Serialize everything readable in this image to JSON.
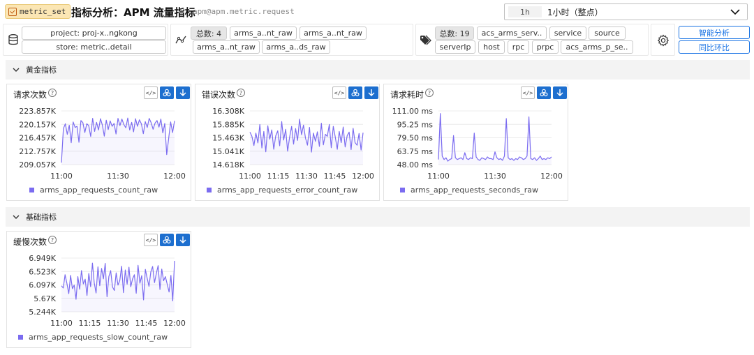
{
  "header": {
    "tag": "metric_set",
    "title": "指标分析：APM 流量指标",
    "subtitle": "apm@apm.metric.request",
    "time_unit": "1h",
    "time_label": "1小时（整点）"
  },
  "filters": {
    "source_group": {
      "project": "project: proj-x..ngkong",
      "store": "store: metric..detail"
    },
    "metric_group": {
      "count": "总数: 4",
      "items": [
        "arms_a..nt_raw",
        "arms_a..nt_raw",
        "arms_a..nt_raw",
        "arms_a..ds_raw"
      ]
    },
    "tag_group": {
      "count": "总数: 19",
      "items": [
        "acs_arms_serv..",
        "service",
        "source",
        "serverIp",
        "host",
        "rpc",
        "prpc",
        "acs_arms_p_se.."
      ]
    },
    "actions": {
      "smart_analysis": "智能分析",
      "compare": "同比环比"
    }
  },
  "sections": {
    "golden": "黄金指标",
    "basic": "基础指标"
  },
  "panels": [
    {
      "title": "请求次数",
      "legend": "arms_app_requests_count_raw",
      "y_ticks": [
        "223.857K",
        "220.157K",
        "216.457K",
        "212.757K",
        "209.057K"
      ],
      "x_ticks": [
        "11:00",
        "11:30",
        "12:00"
      ]
    },
    {
      "title": "错误次数",
      "legend": "arms_app_requests_error_count_raw",
      "y_ticks": [
        "16.308K",
        "15.885K",
        "15.463K",
        "15.041K",
        "14.618K"
      ],
      "x_ticks": [
        "11:00",
        "11:15",
        "11:30",
        "11:45",
        "12:00"
      ]
    },
    {
      "title": "请求耗时",
      "legend": "arms_app_requests_seconds_raw",
      "y_ticks": [
        "111.00 ms",
        "95.25 ms",
        "79.50 ms",
        "63.75 ms",
        "48.00 ms"
      ],
      "x_ticks": [
        "11:00",
        "11:30",
        "12:00"
      ]
    },
    {
      "title": "缓慢次数",
      "legend": "arms_app_requests_slow_count_raw",
      "y_ticks": [
        "6.949K",
        "6.523K",
        "6.097K",
        "5.67K",
        "5.244K"
      ],
      "x_ticks": [
        "11:00",
        "11:15",
        "11:30",
        "11:45",
        "12:00"
      ]
    }
  ],
  "colors": {
    "series": "#7b6cf0",
    "accent": "#1d6fcf",
    "tag_bg": "#fbe6b4"
  },
  "icons": {
    "tag": "checkbox-icon",
    "source": "database-icon",
    "metric": "line-chart-icon",
    "tags": "tag-icon",
    "settings": "gear-icon",
    "code": "code-icon",
    "share": "share-icon",
    "download": "download-icon"
  },
  "chart_data": [
    {
      "type": "line",
      "title": "请求次数",
      "series": [
        {
          "name": "arms_app_requests_count_raw",
          "values": [
            209600,
            219000,
            220300,
            217400,
            219900,
            215100,
            220800,
            219300,
            219600,
            215200,
            221200,
            220600,
            217900,
            220300,
            219800,
            216800,
            221800,
            218200,
            220700,
            218600,
            221700,
            219900,
            216900,
            221300,
            218700,
            221100,
            219600,
            220400,
            217500,
            221800,
            219800,
            221600,
            220100,
            219200,
            221900,
            218600,
            220700,
            218100,
            221700,
            219600,
            221400,
            220300,
            217600,
            220900,
            219300,
            221800,
            220600,
            218800,
            220500,
            221200,
            219400,
            221600,
            217800,
            220400,
            211800,
            216300,
            220800,
            217900,
            221100
          ]
        }
      ],
      "ylim": [
        209057,
        223857
      ]
    },
    {
      "type": "line",
      "title": "错误次数",
      "series": [
        {
          "name": "arms_app_requests_error_count_raw",
          "values": [
            15640,
            15510,
            15220,
            15610,
            15300,
            15880,
            15140,
            15660,
            15020,
            15840,
            15420,
            15710,
            15100,
            15520,
            15680,
            15210,
            15970,
            15390,
            15730,
            15040,
            15480,
            15820,
            15260,
            15750,
            15380,
            16050,
            15560,
            15860,
            15450,
            15230,
            15790,
            15010,
            15610,
            15350,
            15650,
            15190,
            15920,
            15240,
            15570,
            15510,
            15880,
            15150,
            15820,
            15490,
            15100,
            15660,
            15310,
            15800,
            15170,
            15530,
            15640,
            15090,
            15760,
            15310,
            15230,
            15600,
            15080,
            15620
          ]
        }
      ],
      "ylim": [
        14618,
        16308
      ]
    },
    {
      "type": "line",
      "title": "请求耗时",
      "series": [
        {
          "name": "arms_app_requests_seconds_raw",
          "values": [
            54,
            108,
            58,
            54,
            56,
            52,
            54,
            55,
            82,
            56,
            54,
            55,
            56,
            54,
            62,
            55,
            54,
            56,
            55,
            85,
            57,
            54,
            53,
            56,
            55,
            54,
            57,
            55,
            55,
            54,
            63,
            56,
            54,
            55,
            53,
            58,
            102,
            56,
            54,
            55,
            53,
            55,
            54,
            57,
            56,
            54,
            55,
            58,
            104,
            55,
            54,
            56,
            53,
            55,
            58,
            54,
            55,
            54,
            56,
            55,
            57
          ]
        }
      ],
      "ylim": [
        48,
        111
      ]
    },
    {
      "type": "line",
      "title": "缓慢次数",
      "series": [
        {
          "name": "arms_app_requests_slow_count_raw",
          "values": [
            6070,
            6000,
            6420,
            6150,
            5820,
            6400,
            5980,
            6090,
            5640,
            6360,
            5960,
            6550,
            6130,
            6280,
            5760,
            6460,
            6040,
            6790,
            6160,
            5840,
            6670,
            6070,
            6620,
            6290,
            6780,
            5720,
            6360,
            6550,
            6030,
            5920,
            6480,
            6090,
            6240,
            6690,
            5850,
            6570,
            6120,
            6660,
            6040,
            6290,
            6420,
            5830,
            6720,
            6150,
            6390,
            5620,
            6590,
            6310,
            6050,
            6510,
            6680,
            6170,
            6460,
            6710,
            5950,
            6600,
            6230,
            6360,
            6120,
            5870,
            6400,
            5590,
            6860
          ]
        }
      ],
      "ylim": [
        5244,
        6949
      ]
    }
  ]
}
